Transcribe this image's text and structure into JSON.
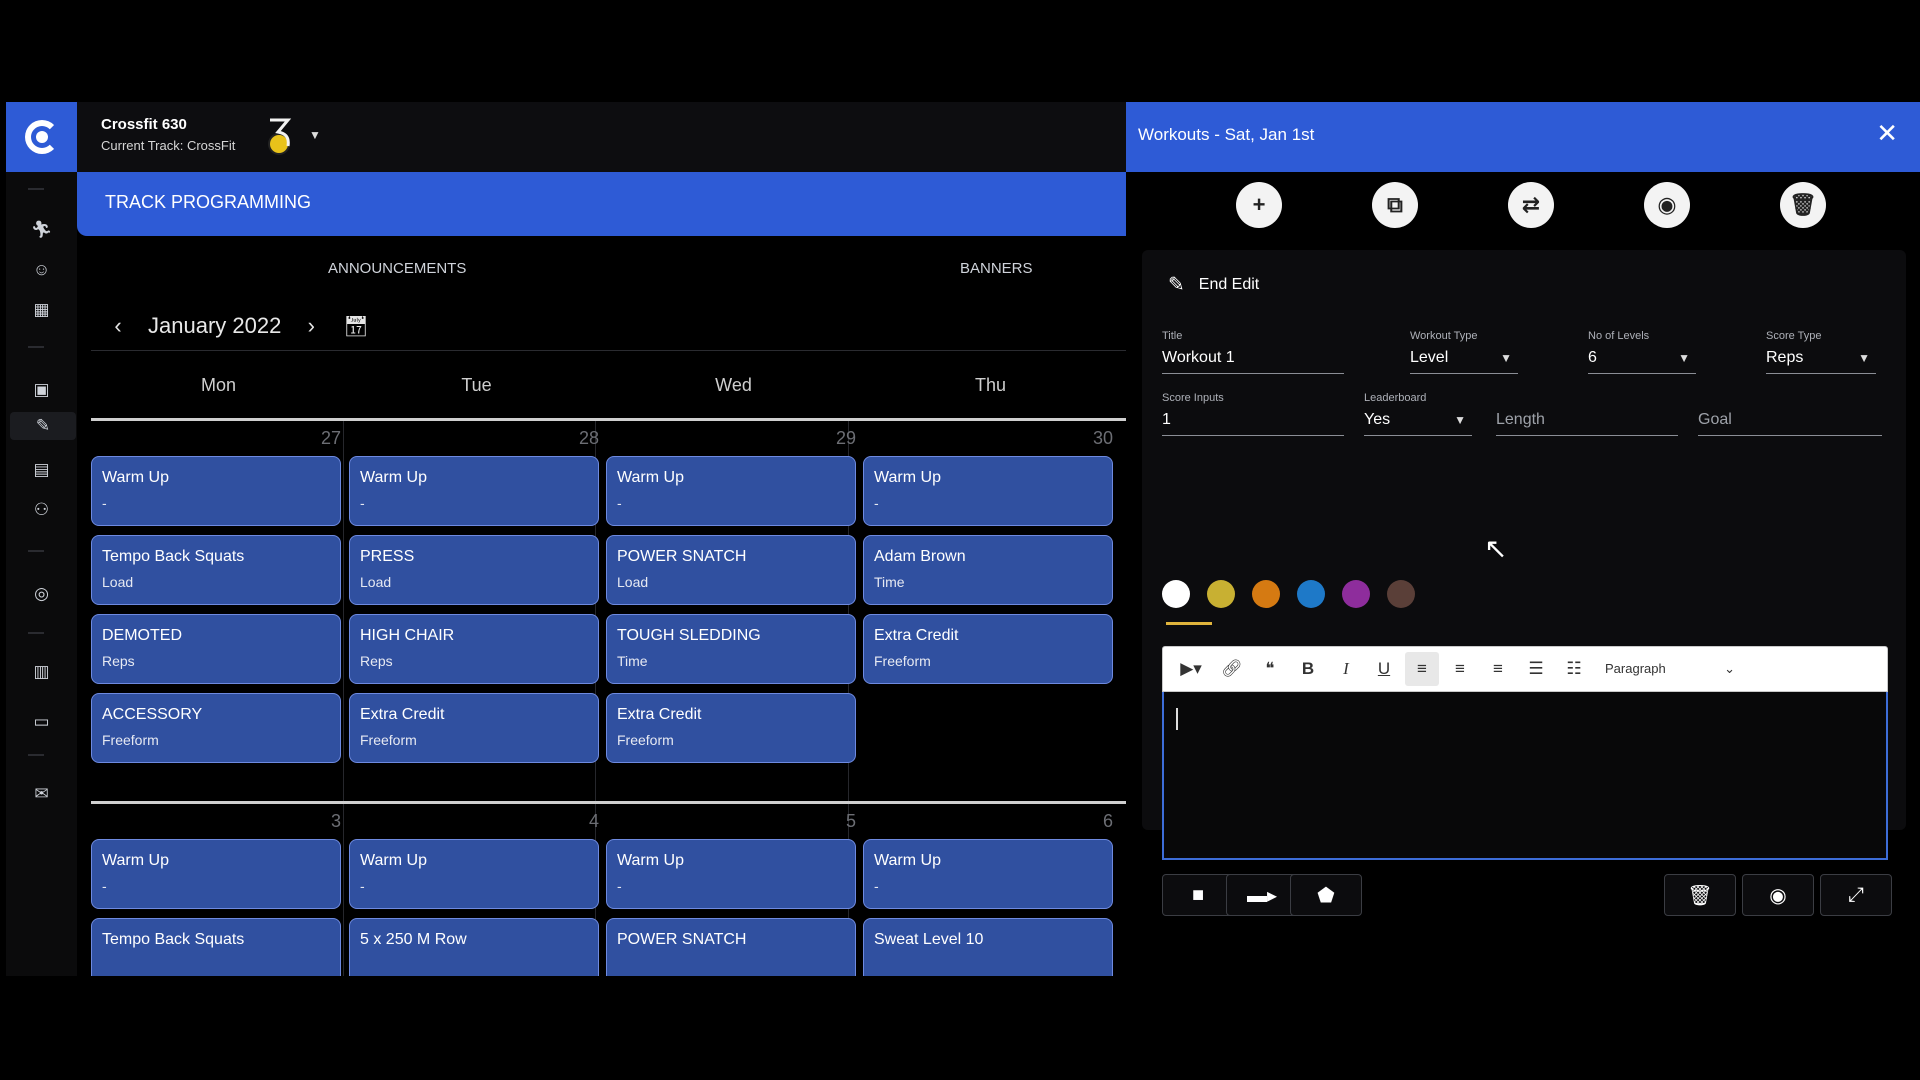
{
  "header": {
    "gym_name": "Crossfit 630",
    "current_track": "Current Track: CrossFit",
    "logo_glyph": "3",
    "track_title": "TRACK PROGRAMMING"
  },
  "tabs": [
    {
      "label": "ANNOUNCEMENTS"
    },
    {
      "label": "BANNERS"
    }
  ],
  "calendar": {
    "month_label": "January 2022",
    "days_of_week": [
      "Mon",
      "Tue",
      "Wed",
      "Thu"
    ],
    "weeks": [
      {
        "day_numbers": [
          "27",
          "28",
          "29",
          "30"
        ],
        "columns": [
          [
            {
              "title": "Warm Up",
              "sub": "-"
            },
            {
              "title": "Tempo Back Squats",
              "sub": "Load"
            },
            {
              "title": "DEMOTED",
              "sub": "Reps"
            },
            {
              "title": "ACCESSORY",
              "sub": "Freeform"
            }
          ],
          [
            {
              "title": "Warm Up",
              "sub": "-"
            },
            {
              "title": "PRESS",
              "sub": "Load"
            },
            {
              "title": "HIGH CHAIR",
              "sub": "Reps"
            },
            {
              "title": "Extra Credit",
              "sub": "Freeform"
            }
          ],
          [
            {
              "title": "Warm Up",
              "sub": "-"
            },
            {
              "title": "POWER SNATCH",
              "sub": "Load"
            },
            {
              "title": "TOUGH SLEDDING",
              "sub": "Time"
            },
            {
              "title": "Extra Credit",
              "sub": "Freeform"
            }
          ],
          [
            {
              "title": "Warm Up",
              "sub": "-"
            },
            {
              "title": "Adam Brown",
              "sub": "Time"
            },
            {
              "title": "Extra Credit",
              "sub": "Freeform"
            }
          ]
        ]
      },
      {
        "day_numbers": [
          "3",
          "4",
          "5",
          "6"
        ],
        "columns": [
          [
            {
              "title": "Warm Up",
              "sub": "-"
            },
            {
              "title": "Tempo Back Squats",
              "sub": ""
            }
          ],
          [
            {
              "title": "Warm Up",
              "sub": "-"
            },
            {
              "title": "5 x 250 M Row",
              "sub": ""
            }
          ],
          [
            {
              "title": "Warm Up",
              "sub": "-"
            },
            {
              "title": "POWER SNATCH",
              "sub": ""
            }
          ],
          [
            {
              "title": "Warm Up",
              "sub": "-"
            },
            {
              "title": "Sweat Level 10",
              "sub": ""
            }
          ]
        ]
      }
    ]
  },
  "panel": {
    "title": "Workouts - Sat, Jan 1st",
    "end_edit_label": "End Edit",
    "fields": {
      "title": {
        "label": "Title",
        "value": "Workout 1"
      },
      "workout_type": {
        "label": "Workout Type",
        "value": "Level"
      },
      "no_of_levels": {
        "label": "No of Levels",
        "value": "6"
      },
      "score_type": {
        "label": "Score Type",
        "value": "Reps"
      },
      "score_inputs": {
        "label": "Score Inputs",
        "value": "1"
      },
      "leaderboard": {
        "label": "Leaderboard",
        "value": "Yes"
      },
      "length": {
        "placeholder": "Length"
      },
      "goal": {
        "placeholder": "Goal"
      }
    },
    "colors": [
      "#ffffff",
      "#c8b032",
      "#d57a12",
      "#1e79c8",
      "#8e2d9c",
      "#5a3f38"
    ],
    "editor_toolbar": {
      "paragraph_label": "Paragraph"
    }
  }
}
